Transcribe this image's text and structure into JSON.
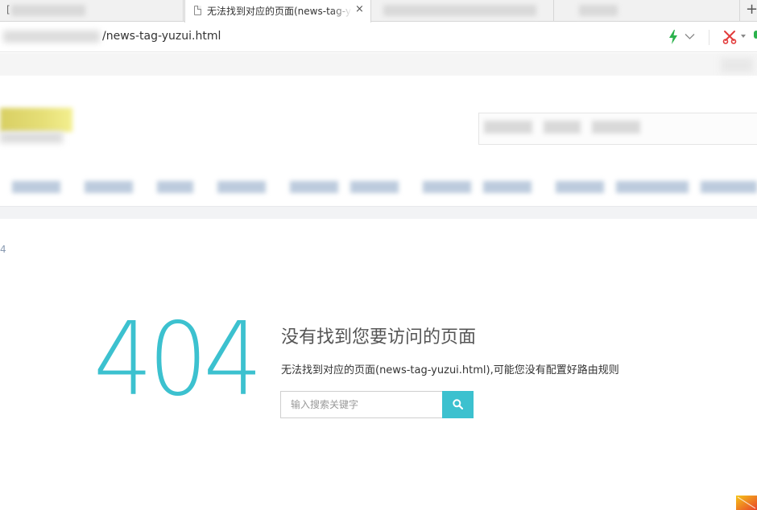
{
  "browser": {
    "tabs": [
      {
        "label": "[",
        "blurred": true
      },
      {
        "label": "无法找到对应的页面(news-tag-yuzui.html)",
        "active": true
      },
      {
        "label": "",
        "blurred": true
      },
      {
        "label": "",
        "blurred": true
      }
    ],
    "close_glyph": "×",
    "new_tab_glyph": "+",
    "url_visible": "/news-tag-yuzui.html",
    "icons": [
      "document-icon",
      "close-icon",
      "bolt-icon",
      "chevron-down-icon",
      "scissors-icon",
      "caret-down-icon",
      "plus-icon"
    ]
  },
  "page": {
    "breadcrumb_fragment": "4",
    "error": {
      "code": "404",
      "title": "没有找到您要访问的页面",
      "description": "无法找到对应的页面(news-tag-yuzui.html),可能您没有配置好路由规则"
    },
    "search": {
      "placeholder": "输入搜索关键字",
      "value": "",
      "button_icon": "search-icon"
    }
  },
  "colors": {
    "accent": "#3cc1cf",
    "bolt": "#2bb24c",
    "scissors": "#e23b3b"
  }
}
